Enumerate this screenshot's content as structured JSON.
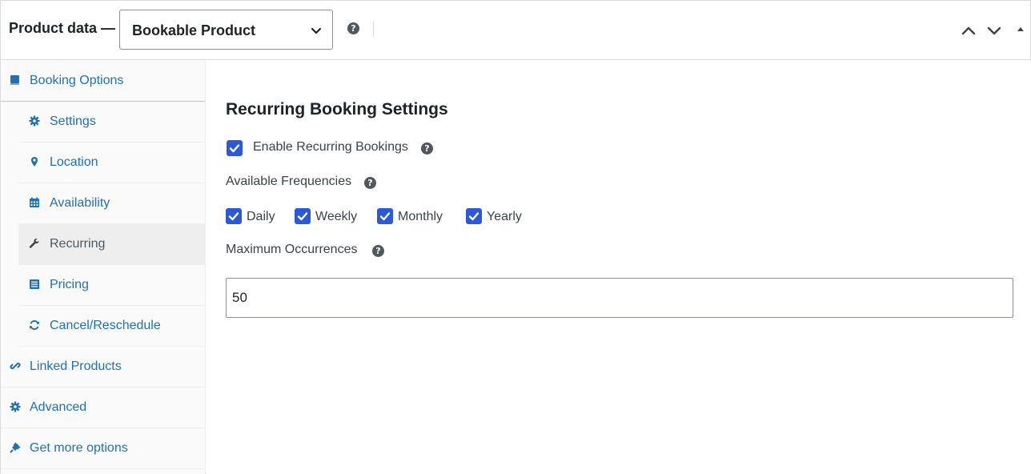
{
  "header": {
    "title": "Product data —",
    "product_type": {
      "selected": "Bookable Product",
      "icon": "chevron-down-icon"
    },
    "help_icon": "question-circle-icon",
    "controls": [
      "chevron-up-icon",
      "chevron-down-icon",
      "triangle-up-icon"
    ]
  },
  "sidebar": {
    "items": [
      {
        "label": "Booking Options",
        "icon": "book-icon",
        "level": "top"
      },
      {
        "label": "Settings",
        "icon": "gear-icon",
        "level": "sub"
      },
      {
        "label": "Location",
        "icon": "map-pin-icon",
        "level": "sub"
      },
      {
        "label": "Availability",
        "icon": "calendar-icon",
        "level": "sub"
      },
      {
        "label": "Recurring",
        "icon": "wrench-icon",
        "level": "sub",
        "active": true
      },
      {
        "label": "Pricing",
        "icon": "list-icon",
        "level": "sub"
      },
      {
        "label": "Cancel/Reschedule",
        "icon": "refresh-icon",
        "level": "sub"
      },
      {
        "label": "Linked Products",
        "icon": "link-icon",
        "level": "top"
      },
      {
        "label": "Advanced",
        "icon": "gear-icon",
        "level": "top"
      },
      {
        "label": "Get more options",
        "icon": "plugin-icon",
        "level": "top"
      }
    ]
  },
  "main": {
    "section_title": "Recurring Booking Settings",
    "enable": {
      "label": "Enable Recurring Bookings",
      "checked": true
    },
    "frequencies": {
      "label": "Available Frequencies",
      "options": [
        {
          "label": "Daily",
          "checked": true
        },
        {
          "label": "Weekly",
          "checked": true
        },
        {
          "label": "Monthly",
          "checked": true
        },
        {
          "label": "Yearly",
          "checked": true
        }
      ]
    },
    "max_occurrences": {
      "label": "Maximum Occurrences",
      "value": "50"
    }
  },
  "colors": {
    "link": "#2271b1",
    "checkbox": "#2c5ad6",
    "active_bg": "#eeeeee",
    "sidebar_bg": "#fafafa",
    "help_icon": "#50575e"
  }
}
